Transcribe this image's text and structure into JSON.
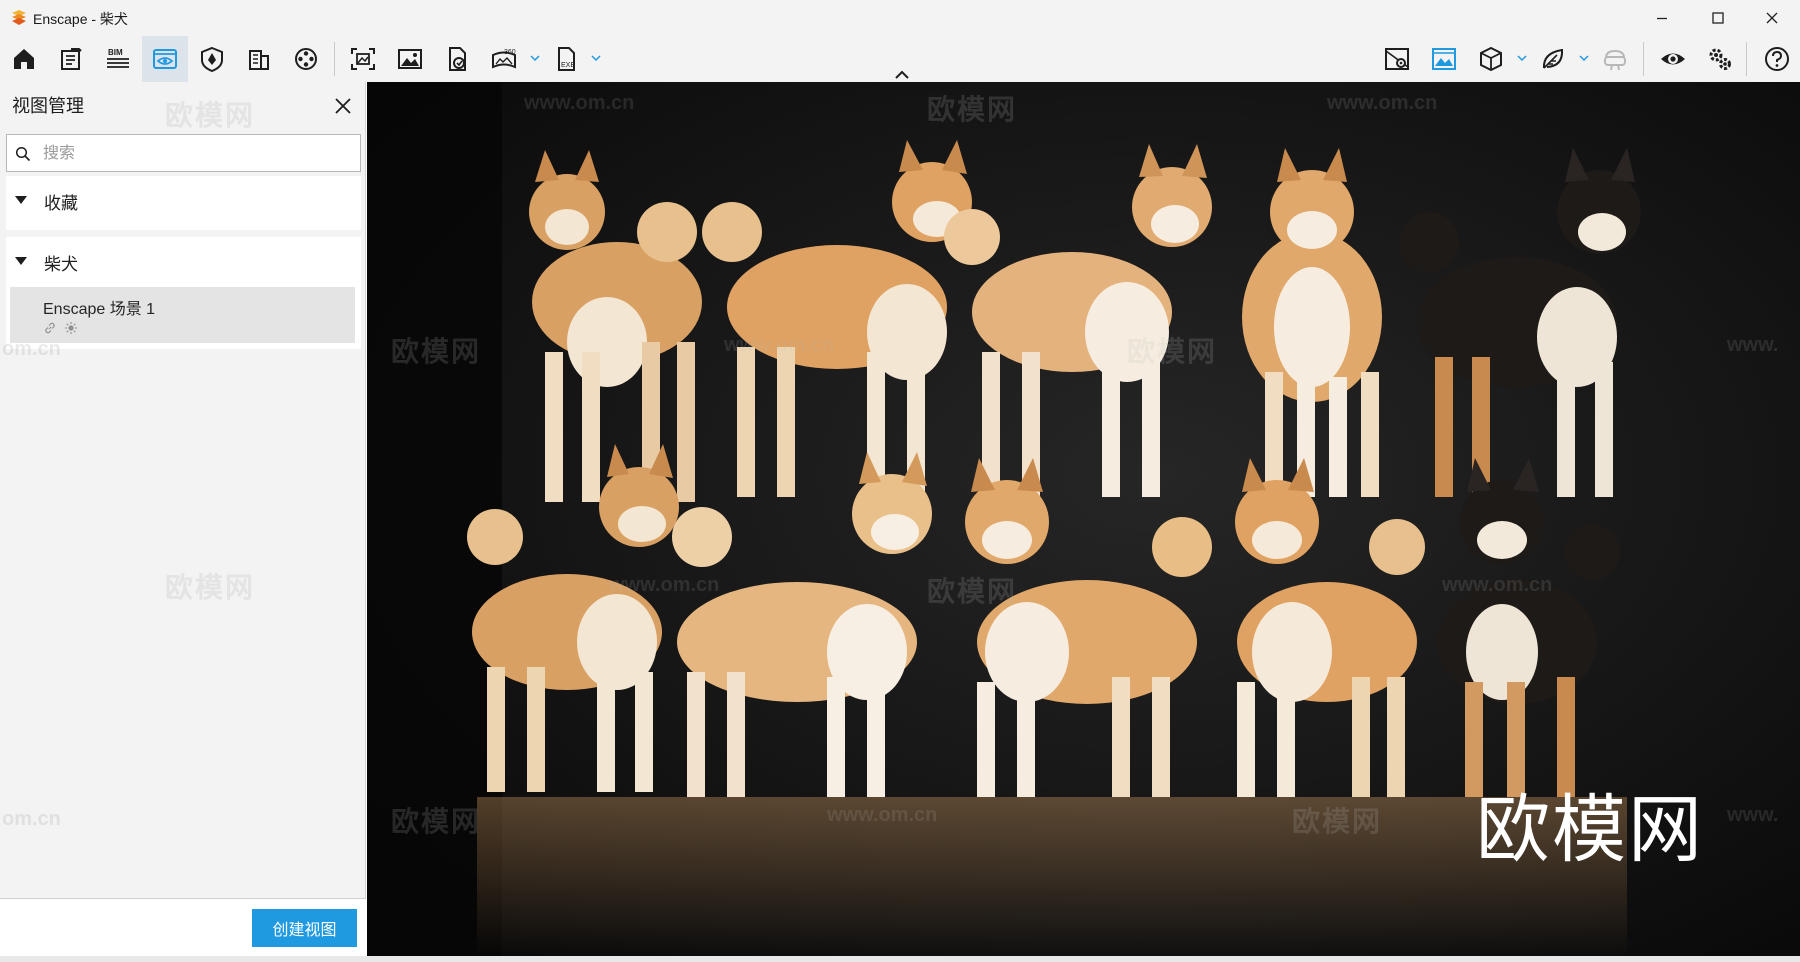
{
  "window": {
    "title": "Enscape - 柴犬",
    "controls": {
      "minimize": "minimize",
      "maximize": "maximize",
      "close": "close"
    }
  },
  "toolbar": {
    "bim_label": "BIM",
    "pano_badge": "360",
    "exe_badge": "EXE",
    "left_tools": [
      "home-icon",
      "document-icon",
      "bim-icon",
      "view-eye-icon",
      "asset-shield-icon",
      "building-icon",
      "film-icon",
      "screenshot-frame-icon",
      "image-icon",
      "file-export-icon",
      "panorama-360-icon",
      "exe-export-icon"
    ],
    "right_tools": [
      "map-pin-icon",
      "landscape-image-icon",
      "cube-icon",
      "leaf-icon",
      "vr-headset-icon",
      "eye-icon",
      "settings-gears-icon",
      "help-icon"
    ]
  },
  "panel": {
    "title": "视图管理",
    "search_placeholder": "搜索",
    "groups": [
      {
        "label": "收藏"
      },
      {
        "label": "柴犬",
        "items": [
          {
            "name": "Enscape 场景 1"
          }
        ]
      }
    ],
    "create_button": "创建视图"
  },
  "viewport": {
    "watermark_cn": "欧模网",
    "watermark_url": "www.om.cn",
    "watermark_url_short": "om.cn",
    "watermark_url_prefix": "www.",
    "brand_mark": "欧模网",
    "scene_description_colors": {
      "bg": "#111111",
      "shiba_red": "#d9a064",
      "shiba_cream": "#f3e6d2",
      "shiba_black": "#1d1a18"
    }
  },
  "colors": {
    "accent": "#1f9ae0",
    "chrome": "#f3f3f3",
    "active_tool": "#dde3ea"
  }
}
